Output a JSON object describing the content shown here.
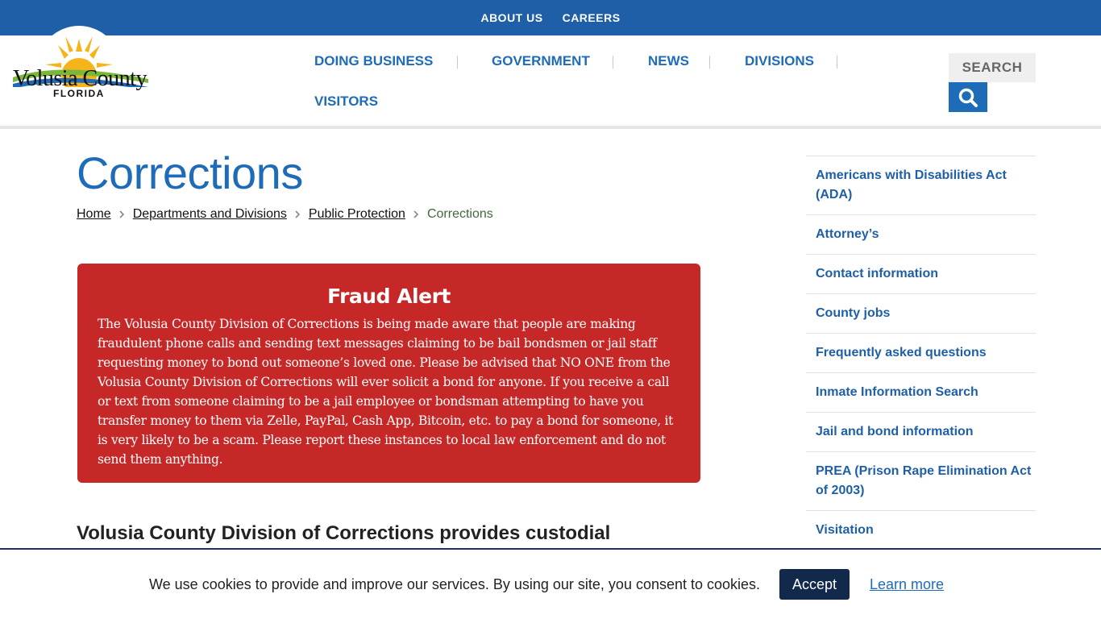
{
  "topbar": {
    "about": "ABOUT US",
    "careers": "CAREERS"
  },
  "logo": {
    "name": "Volusia County",
    "state": "FLORIDA"
  },
  "nav": {
    "items": [
      "DOING BUSINESS",
      "GOVERNMENT",
      "NEWS",
      "DIVISIONS",
      "VISITORS"
    ]
  },
  "search": {
    "placeholder": "SEARCH",
    "icon": "magnifier-icon"
  },
  "page": {
    "title": "Corrections"
  },
  "breadcrumb": {
    "items": [
      "Home",
      "Departments and Divisions",
      "Public Protection"
    ],
    "current": "Corrections"
  },
  "alert": {
    "title": "Fraud Alert",
    "body": "The Volusia County Division of Corrections is being made aware that people are making fraudulent phone calls and sending text messages claiming to be bail bondsmen or jail staff requesting money to bond out someone’s loved one. Please be advised that NO ONE from the Volusia County Division of Corrections will ever solicit a bond for anyone. If you receive a call or text from someone claiming to be a jail employee or bondsman attempting to have you transfer money to them via Zelle, PayPal, Cash App, Bitcoin, etc. to pay a bond for someone, it is very likely to be a scam. Please report these instances to local law enforcement and do not send them anything.",
    "color": "#c62828"
  },
  "section": {
    "heading": "Volusia County Division of Corrections provides custodial"
  },
  "sidebar": {
    "items": [
      "Americans with Disabilities Act (ADA)",
      "Attorney’s",
      "Contact information",
      "County jobs",
      "Frequently asked questions",
      "Inmate Information Search",
      "Jail and bond information",
      "PREA (Prison Rape Elimination Act of 2003)",
      "Visitation"
    ]
  },
  "cookie": {
    "text": "We use cookies to provide and improve our services. By using our site, you consent to cookies.",
    "accept": "Accept",
    "learn": "Learn more"
  },
  "colors": {
    "brand_blue": "#1e5fa7",
    "link_blue": "#1e6bb8",
    "alert_red": "#c62828",
    "cookie_navy": "#13294b"
  }
}
